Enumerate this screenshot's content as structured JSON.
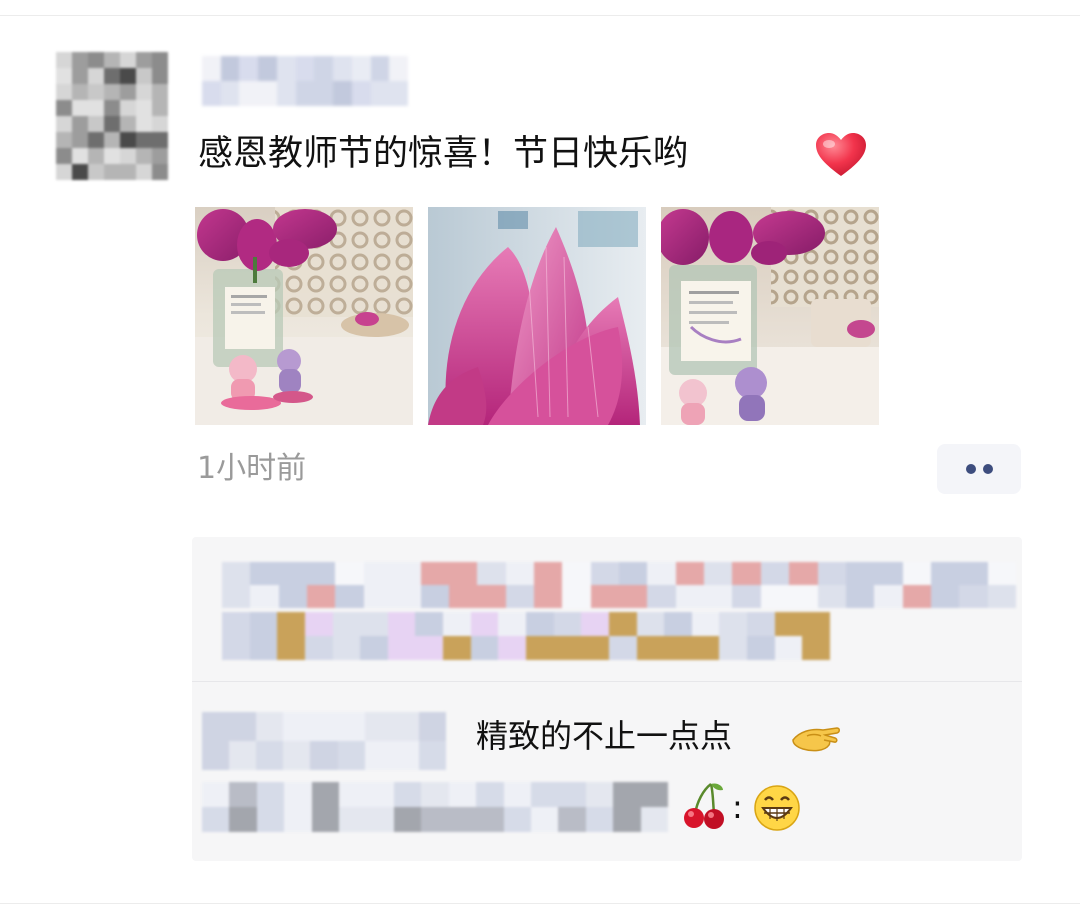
{
  "post": {
    "text": "感恩教师节的惊喜！节日快乐哟",
    "emoji": "heart-icon",
    "images": [
      {
        "name": "lotus-vase-photo-1"
      },
      {
        "name": "lotus-bud-closeup-photo"
      },
      {
        "name": "lotus-vase-photo-2"
      }
    ],
    "timestamp": "1小时前"
  },
  "comments": [
    {
      "text": "精致的不止一点点",
      "emoji": "pinch-icon"
    },
    {
      "text": ":",
      "emoji": "cherries-icon",
      "trailing_emoji": "grin-icon"
    }
  ],
  "colors": {
    "more_dots": "#3d4d7e",
    "comment_bg": "#f6f6f7",
    "timestamp": "#9a9a9a"
  }
}
